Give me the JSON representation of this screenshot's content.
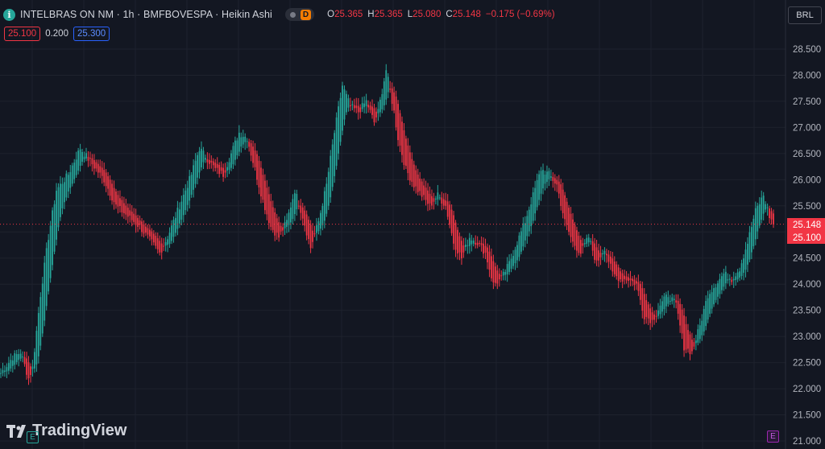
{
  "header": {
    "title": "INTELBRAS ON NM · 1h · BMFBOVESPA · Heikin Ashi",
    "info_icon_glyph": "i",
    "badge": "D",
    "ohlc": [
      {
        "label": "O",
        "value": "25.365"
      },
      {
        "label": "H",
        "value": "25.365"
      },
      {
        "label": "L",
        "value": "25.080"
      },
      {
        "label": "C",
        "value": "25.148"
      }
    ],
    "change": "−0.175 (−0.69%)"
  },
  "order_row": {
    "sell": "25.100",
    "spread": "0.200",
    "buy": "25.300"
  },
  "currency": "BRL",
  "price_tags": {
    "last": "25.148",
    "bid": "25.100"
  },
  "branding": {
    "name": "TradingView"
  },
  "event_markers": [
    "E",
    "E"
  ],
  "colors": {
    "up": "#26a69a",
    "down": "#f23645",
    "background": "#131722",
    "grid": "#1e222d",
    "buy": "#2962ff"
  },
  "chart_data": {
    "type": "candlestick",
    "style": "Heikin Ashi",
    "interval": "1h",
    "ylim": [
      21.0,
      28.75
    ],
    "yticks": [
      "28.500",
      "28.000",
      "27.500",
      "27.000",
      "26.500",
      "26.000",
      "25.500",
      "25.000",
      "24.500",
      "24.000",
      "23.500",
      "23.000",
      "22.500",
      "22.000",
      "21.500",
      "21.000"
    ],
    "last_price": 25.148,
    "anchors": [
      [
        0,
        22.3
      ],
      [
        6,
        22.6
      ],
      [
        10,
        22.7
      ],
      [
        14,
        22.2
      ],
      [
        16,
        22.4
      ],
      [
        20,
        23.8
      ],
      [
        24,
        24.9
      ],
      [
        28,
        25.8
      ],
      [
        34,
        26.1
      ],
      [
        40,
        26.6
      ],
      [
        46,
        26.3
      ],
      [
        52,
        26.0
      ],
      [
        58,
        25.5
      ],
      [
        64,
        25.3
      ],
      [
        70,
        25.1
      ],
      [
        76,
        24.8
      ],
      [
        80,
        24.6
      ],
      [
        84,
        24.9
      ],
      [
        90,
        25.5
      ],
      [
        96,
        26.1
      ],
      [
        100,
        26.6
      ],
      [
        104,
        26.4
      ],
      [
        108,
        26.2
      ],
      [
        112,
        26.1
      ],
      [
        116,
        26.5
      ],
      [
        120,
        26.9
      ],
      [
        124,
        26.8
      ],
      [
        128,
        26.2
      ],
      [
        132,
        25.6
      ],
      [
        136,
        25.1
      ],
      [
        140,
        24.9
      ],
      [
        144,
        25.2
      ],
      [
        148,
        25.8
      ],
      [
        152,
        25.3
      ],
      [
        156,
        24.7
      ],
      [
        160,
        25.2
      ],
      [
        164,
        25.9
      ],
      [
        168,
        26.9
      ],
      [
        172,
        27.8
      ],
      [
        176,
        27.4
      ],
      [
        180,
        27.3
      ],
      [
        184,
        27.5
      ],
      [
        188,
        27.1
      ],
      [
        190,
        27.3
      ],
      [
        194,
        28.1
      ],
      [
        198,
        27.3
      ],
      [
        200,
        26.8
      ],
      [
        204,
        26.2
      ],
      [
        208,
        25.9
      ],
      [
        212,
        25.7
      ],
      [
        216,
        25.5
      ],
      [
        220,
        25.7
      ],
      [
        224,
        25.5
      ],
      [
        228,
        24.8
      ],
      [
        232,
        24.5
      ],
      [
        236,
        24.9
      ],
      [
        240,
        24.8
      ],
      [
        244,
        24.6
      ],
      [
        248,
        24.0
      ],
      [
        252,
        24.1
      ],
      [
        256,
        24.4
      ],
      [
        260,
        24.8
      ],
      [
        264,
        25.2
      ],
      [
        268,
        25.7
      ],
      [
        272,
        26.2
      ],
      [
        276,
        26.1
      ],
      [
        280,
        25.9
      ],
      [
        284,
        25.2
      ],
      [
        288,
        24.8
      ],
      [
        292,
        24.6
      ],
      [
        296,
        24.9
      ],
      [
        300,
        24.4
      ],
      [
        304,
        24.7
      ],
      [
        308,
        24.2
      ],
      [
        312,
        24.1
      ],
      [
        316,
        24.1
      ],
      [
        320,
        24.0
      ],
      [
        324,
        23.4
      ],
      [
        328,
        23.3
      ],
      [
        332,
        23.6
      ],
      [
        336,
        23.8
      ],
      [
        340,
        23.6
      ],
      [
        344,
        22.8
      ],
      [
        348,
        22.7
      ],
      [
        352,
        23.2
      ],
      [
        356,
        23.8
      ],
      [
        360,
        24.0
      ],
      [
        364,
        24.2
      ],
      [
        368,
        24.1
      ],
      [
        372,
        24.3
      ],
      [
        376,
        24.8
      ],
      [
        380,
        25.4
      ],
      [
        384,
        25.7
      ],
      [
        387,
        25.3
      ],
      [
        389,
        25.15
      ]
    ]
  }
}
